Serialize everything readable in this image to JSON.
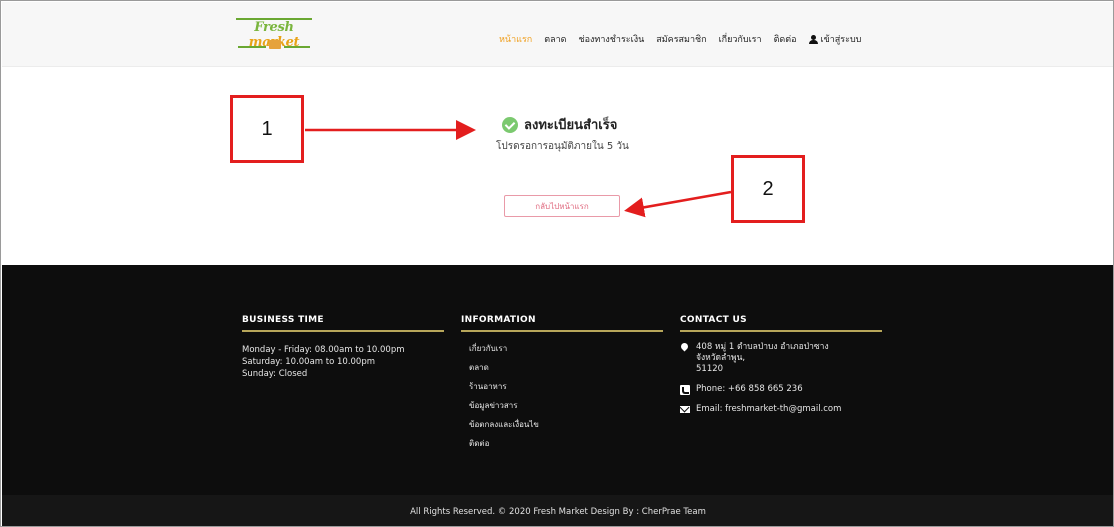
{
  "header": {
    "logo": {
      "word1": "Fresh",
      "word2": "market"
    },
    "nav": {
      "home": "หน้าแรก",
      "market": "ตลาด",
      "payment": "ช่องทางชำระเงิน",
      "register": "สมัครสมาชิก",
      "about": "เกี่ยวกับเรา",
      "contact": "ติดต่อ",
      "login": "เข้าสู่ระบบ"
    },
    "active_color": "#f0a020"
  },
  "main": {
    "title": "ลงทะเบียนสำเร็จ",
    "subtitle": "โปรดรอการอนุมัติภายใน 5 วัน",
    "back_button": "กลับไปหน้าแรก",
    "success_icon": "check-circle-icon",
    "success_color": "#7bc96f"
  },
  "annotations": {
    "label1": "1",
    "label2": "2",
    "color": "#e31e1e"
  },
  "footer": {
    "business": {
      "title": "BUSINESS TIME",
      "line1": "Monday - Friday: 08.00am to 10.00pm",
      "line2": "Saturday: 10.00am to 10.00pm",
      "line3": "Sunday: Closed"
    },
    "information": {
      "title": "INFORMATION",
      "items": [
        "เกี่ยวกับเรา",
        "ตลาด",
        "ร้านอาหาร",
        "ข้อมูลข่าวสาร",
        "ข้อตกลงและเงื่อนไข",
        "ติดต่อ"
      ]
    },
    "contact": {
      "title": "CONTACT US",
      "address1": "408 หมู่ 1 ตำบลป่าบง อำเภอป่าซาง",
      "address2": "จังหวัดลำพูน,",
      "address3": "51120",
      "phone": "Phone: +66 858 665 236",
      "email": "Email: freshmarket-th@gmail.com"
    },
    "copyright": "All Rights Reserved. © 2020 Fresh Market Design By : CherPrae Team",
    "rule_color": "#b7a65a"
  }
}
